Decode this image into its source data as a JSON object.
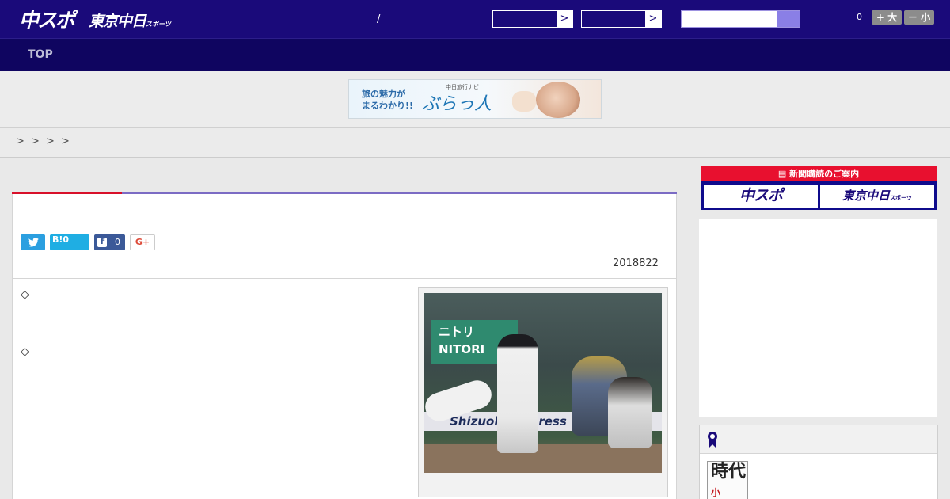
{
  "header": {
    "logo_main": "中スポ",
    "logo_tokyo": "東京中日",
    "logo_tokyo_suffix": "スポーツ",
    "slash": "/",
    "select_arrow": ">",
    "font_size_value": "0",
    "font_larger_label": "+ 大",
    "font_smaller_label": "－ 小"
  },
  "nav": {
    "top_label": "TOP"
  },
  "banner": {
    "line1": "旅の魅力が",
    "line2": "まるわかり!!",
    "small": "中日旅行ナビ",
    "logo": "ぶらっ人"
  },
  "breadcrumb": {
    "separators": [
      ">",
      ">",
      ">",
      ">"
    ]
  },
  "share": {
    "twitter_icon": "twitter-icon",
    "hatena_label": "B!0",
    "facebook_count": "0",
    "google_label": "G+"
  },
  "article": {
    "date": "2018822",
    "bullet1": "◇",
    "bullet2": "◇"
  },
  "photo": {
    "sign_line1": "ニトリ",
    "sign_line2": "NITORI",
    "wall_text": "Shizuoka Express"
  },
  "sidebar": {
    "subscribe_header": "新聞購読のご案内",
    "subscribe_chuspo": "中スポ",
    "subscribe_tokyo": "東京中日",
    "subscribe_tokyo_suffix": "スポーツ",
    "book_title": "時代",
    "book_mark": "小"
  },
  "colors": {
    "header_bg": "#1a0a7a",
    "nav_bg": "#0f0560",
    "accent_red": "#d8102a",
    "accent_purple": "#7b6bc4"
  }
}
